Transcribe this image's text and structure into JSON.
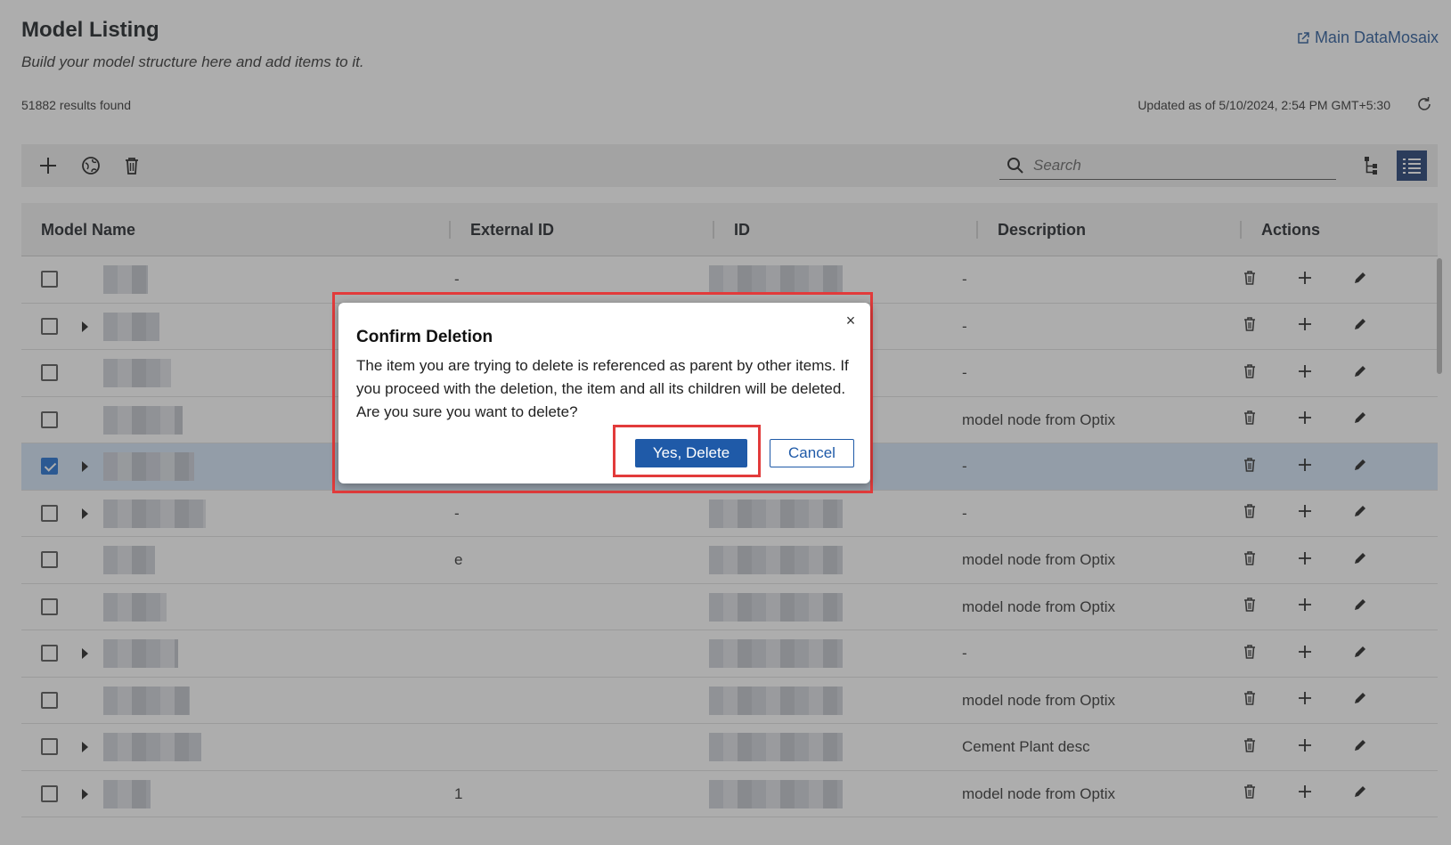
{
  "header": {
    "title": "Model Listing",
    "subtitle": "Build your model structure here and add items to it.",
    "main_link": "Main DataMosaix",
    "results": "51882 results found",
    "updated": "Updated as of 5/10/2024, 2:54 PM GMT+5:30"
  },
  "toolbar": {
    "search_placeholder": "Search",
    "icons": [
      "plus-icon",
      "globe-refresh-icon",
      "trash-icon",
      "tree-view-icon",
      "list-view-icon"
    ]
  },
  "table": {
    "columns": [
      "Model Name",
      "External ID",
      "ID",
      "Description",
      "Actions"
    ],
    "rows": [
      {
        "external_id": "-",
        "description": "-",
        "expand": false,
        "checked": false
      },
      {
        "external_id": "",
        "description": "-",
        "expand": true,
        "checked": false
      },
      {
        "external_id": "",
        "description": "-",
        "expand": false,
        "checked": false
      },
      {
        "external_id": "",
        "description": "model node from Optix",
        "expand": false,
        "checked": false
      },
      {
        "external_id": "",
        "description": "-",
        "expand": true,
        "checked": true
      },
      {
        "external_id": "-",
        "description": "-",
        "expand": true,
        "checked": false
      },
      {
        "external_id": "e",
        "description": "model node from Optix",
        "expand": false,
        "checked": false
      },
      {
        "external_id": "",
        "description": "model node from Optix",
        "expand": false,
        "checked": false
      },
      {
        "external_id": "",
        "description": "-",
        "expand": true,
        "checked": false
      },
      {
        "external_id": "",
        "description": "model node from Optix",
        "expand": false,
        "checked": false
      },
      {
        "external_id": "",
        "description": "Cement Plant desc",
        "expand": true,
        "checked": false
      },
      {
        "external_id": "1",
        "description": "model node from Optix",
        "expand": true,
        "checked": false
      }
    ]
  },
  "dialog": {
    "title": "Confirm Deletion",
    "body": "The item you are trying to delete is referenced as parent by other items. If you proceed with the deletion, the item and all its children will be deleted. Are you sure you want to delete?",
    "confirm_label": "Yes, Delete",
    "cancel_label": "Cancel",
    "close_symbol": "×"
  },
  "colors": {
    "accent": "#1f5aa8",
    "highlight": "#e23b3b",
    "selected_row": "#d2e3f6"
  }
}
